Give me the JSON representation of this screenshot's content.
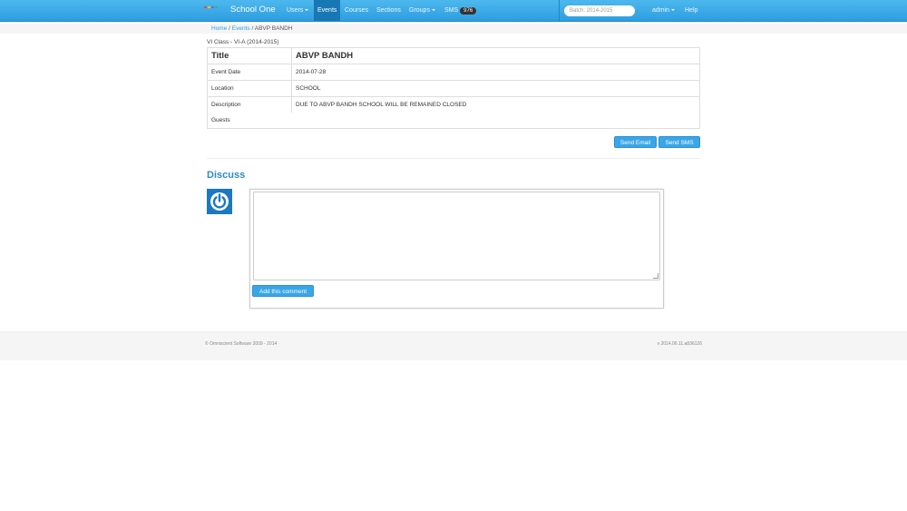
{
  "nav": {
    "brand": "School One",
    "items": [
      {
        "label": "Users",
        "dropdown": true
      },
      {
        "label": "Events",
        "active": true
      },
      {
        "label": "Courses"
      },
      {
        "label": "Sections"
      },
      {
        "label": "Groups",
        "dropdown": true
      },
      {
        "label": "SMS",
        "badge": "976"
      }
    ],
    "search_value": "Batch: 2014-2015",
    "user": "admin",
    "help": "Help",
    "colors": {
      "bar": "#2e9ee0",
      "active": "#1877b5"
    }
  },
  "breadcrumb": {
    "home": "Home",
    "sep": "/",
    "events": "Events",
    "current": "ABVP BANDH"
  },
  "event": {
    "class_line": "VI Class - VI-A (2014-2015)",
    "title_label": "Title",
    "title": "ABVP BANDH",
    "rows": [
      {
        "label": "Event Date",
        "value": "2014-07-28"
      },
      {
        "label": "Location",
        "value": "SCHOOL"
      },
      {
        "label": "Description",
        "value": "DUE TO ABVP BANDH SCHOOL WILL BE REMAINED CLOSED"
      },
      {
        "label": "Guests",
        "value": ""
      }
    ]
  },
  "actions": {
    "send_email": "Send Email",
    "send_sms": "Send SMS"
  },
  "discuss": {
    "heading": "Discuss",
    "avatar_icon": "power-icon",
    "add_comment": "Add this comment"
  },
  "footer": {
    "left": "© Omniscient Software 2009 - 2014",
    "right": "v 2014.06.11.a836126"
  }
}
